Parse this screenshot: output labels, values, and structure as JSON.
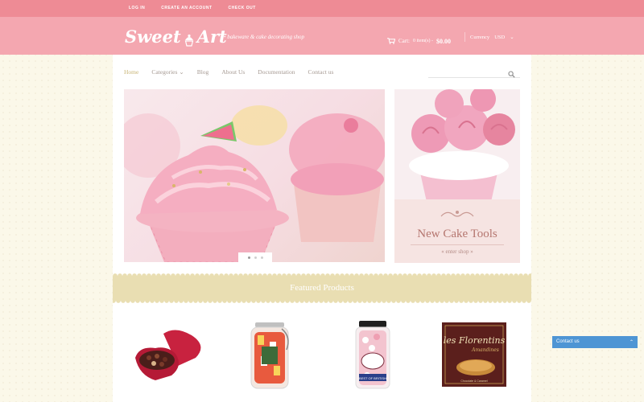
{
  "topbar": {
    "links": [
      "LOG IN",
      "CREATE AN ACCOUNT",
      "CHECK OUT"
    ]
  },
  "header": {
    "logo_text_1": "Sweet",
    "logo_text_2": "Art",
    "tagline": "• bakeware & cake decorating shop",
    "cart_label": "Cart:",
    "cart_items": "0 item(s) -",
    "cart_total": "$0.00",
    "currency_label": "Currency",
    "currency_value": "USD"
  },
  "nav": {
    "items": [
      "Home",
      "Categories",
      "Blog",
      "About Us",
      "Documentation",
      "Contact us"
    ],
    "active": "Home",
    "categories_arrow": "⌄"
  },
  "search": {
    "placeholder": ""
  },
  "banner": {
    "title": "New Cake Tools",
    "link": "enter shop",
    "link_arrows": [
      "«",
      "»"
    ]
  },
  "featured": {
    "title": "Featured Products"
  },
  "products": [
    "heart-chocolate-box",
    "candy-jar-red",
    "candy-jar-pink",
    "les-florentins-box"
  ],
  "florentins_box": {
    "brand": "les Florentins",
    "sub": "Amandines",
    "footer": "Chocolate & Caramel"
  },
  "jar_label": {
    "brand": "BEST OF BRITISH"
  },
  "contact": {
    "label": "Contact us",
    "arrow": "⌃"
  },
  "colors": {
    "topbar": "#ee8b95",
    "header": "#f4a7b0",
    "featured": "#e9deb2",
    "contact": "#4e95d4",
    "nav_active": "#c9b577"
  }
}
